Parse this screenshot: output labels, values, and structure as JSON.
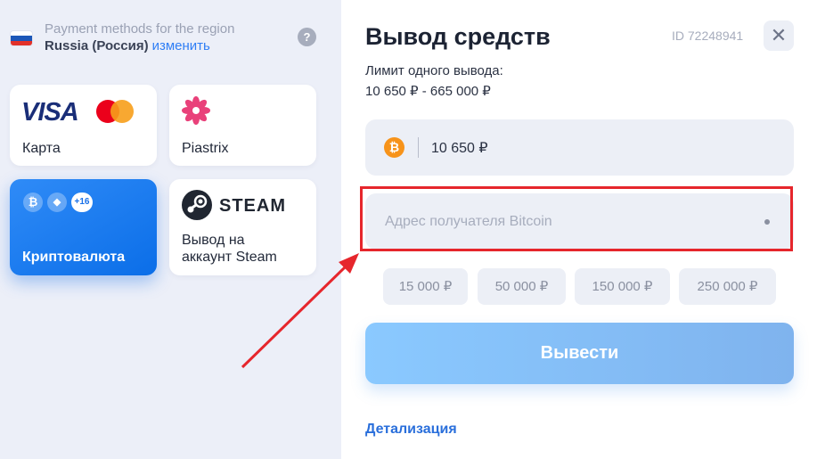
{
  "region": {
    "title": "Payment methods for the region",
    "value": "Russia (Россия)",
    "change_link": "изменить",
    "help_glyph": "?",
    "flag_colors": [
      "#ffffff",
      "#1c57b8",
      "#e2312a"
    ]
  },
  "methods": [
    {
      "id": "card",
      "label": "Карта",
      "logo_text": "VISA",
      "icons": [
        "visa-logo",
        "mastercard-logo"
      ]
    },
    {
      "id": "piastrix",
      "label": "Piastrix",
      "icons": [
        "piastrix-flower-logo"
      ]
    },
    {
      "id": "crypto",
      "label": "Криптовалюта",
      "active": true,
      "coins": [
        "₿",
        "◆"
      ],
      "more_badge": "+16"
    },
    {
      "id": "steam",
      "label_line1": "Вывод на",
      "label_line2": "аккаунт Steam",
      "logo_text": "STEAM",
      "icons": [
        "steam-logo"
      ]
    }
  ],
  "withdraw_panel": {
    "title": "Вывод средств",
    "user_id": "ID 72248941",
    "close_glyph": "✕",
    "limit_label": "Лимит одного вывода:",
    "limit_value": "10 650 ₽ - 665 000 ₽",
    "amount": {
      "currency_icon": "bitcoin-icon",
      "currency_glyph": "₿",
      "value": "10 650 ₽"
    },
    "address": {
      "placeholder": "Адрес получателя Bitcoin",
      "value": ""
    },
    "quick_amounts": [
      "15 000 ₽",
      "50 000 ₽",
      "150 000 ₽",
      "250 000 ₽"
    ],
    "submit_label": "Вывести",
    "details_link": "Детализация"
  },
  "colors": {
    "accent": "#2f7ef5",
    "active_card": "#0b6ee8",
    "highlight": "#e6262c",
    "bitcoin": "#f7931a",
    "submit": "#85bff8"
  }
}
